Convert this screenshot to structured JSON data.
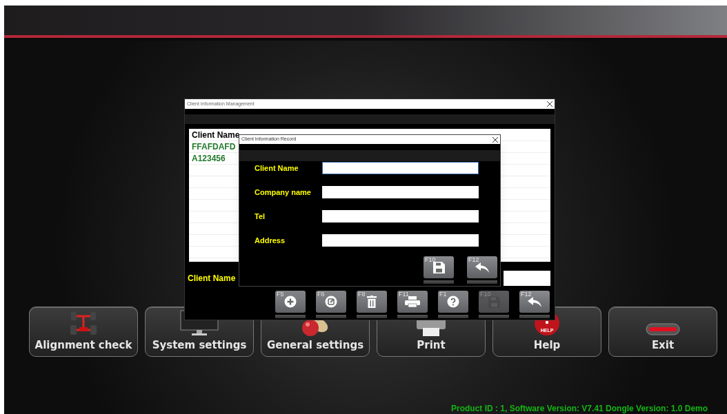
{
  "main_window": {
    "title": "Client Information Management",
    "table": {
      "columns": [
        "Client Name"
      ],
      "rows": [
        [
          "FFAFDAFD"
        ],
        [
          "A123456"
        ]
      ]
    },
    "search_label": "Client Name",
    "toolbar": [
      {
        "key": "F5",
        "kind": "add",
        "disabled": false
      },
      {
        "key": "F6",
        "kind": "edit",
        "disabled": false
      },
      {
        "key": "F8",
        "kind": "delete",
        "disabled": false
      },
      {
        "key": "F11",
        "kind": "print",
        "disabled": false
      },
      {
        "key": "F1",
        "kind": "help",
        "disabled": false
      },
      {
        "key": "F10",
        "kind": "save",
        "disabled": true
      },
      {
        "key": "F12",
        "kind": "back",
        "disabled": false
      }
    ]
  },
  "dialog": {
    "title": "Client Information Record",
    "fields": [
      {
        "label": "Client Name",
        "focused": true
      },
      {
        "label": "Company name",
        "focused": false
      },
      {
        "label": "Tel",
        "focused": false
      },
      {
        "label": "Address",
        "focused": false
      }
    ],
    "buttons": [
      {
        "key": "F10",
        "kind": "save",
        "disabled": false
      },
      {
        "key": "F12",
        "kind": "back",
        "disabled": false
      }
    ]
  },
  "menu": [
    {
      "label": "Alignment check",
      "kind": "alignment"
    },
    {
      "label": "System settings",
      "kind": "system"
    },
    {
      "label": "General settings",
      "kind": "general"
    },
    {
      "label": "Print",
      "kind": "print"
    },
    {
      "label": "Help",
      "kind": "help",
      "badge": "HELP"
    },
    {
      "label": "Exit",
      "kind": "exit"
    }
  ],
  "status_text": "Product ID : 1, Software Version: V7.41 Dongle Version: 1.0 Demo"
}
